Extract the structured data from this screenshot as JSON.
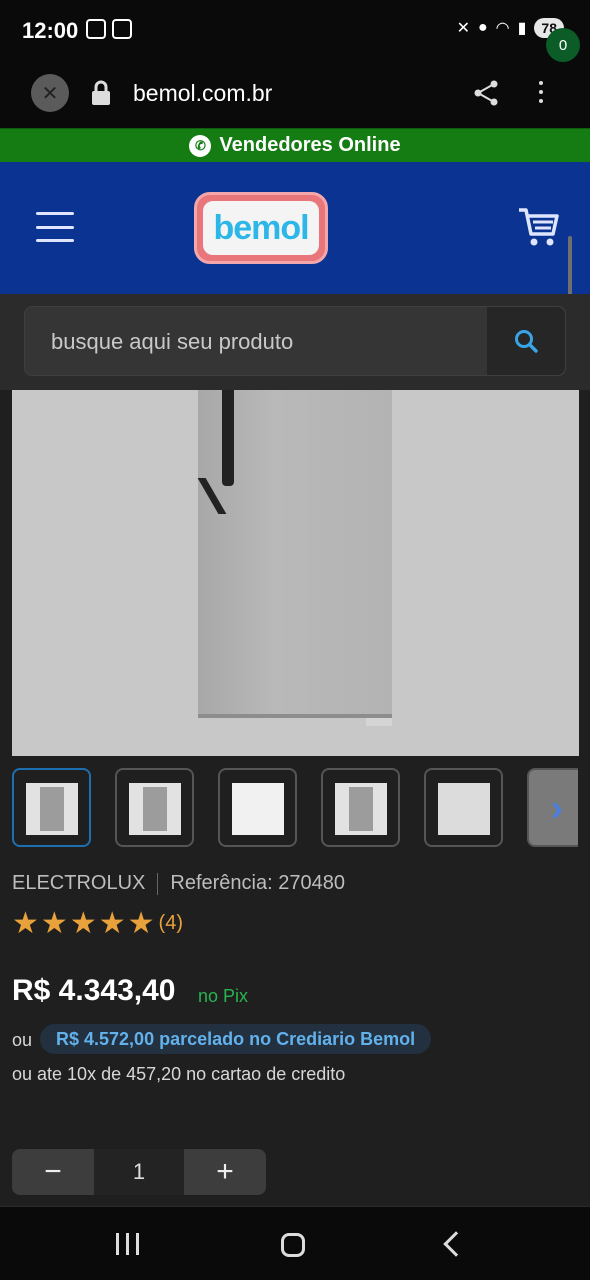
{
  "status": {
    "time": "12:00",
    "battery": "78"
  },
  "browser": {
    "url": "bemol.com.br"
  },
  "banner": {
    "label": "Vendedores Online"
  },
  "header": {
    "logo_text": "bemol",
    "cart_count": "0"
  },
  "search": {
    "placeholder": "busque aqui seu produto"
  },
  "product": {
    "brand": "ELECTROLUX",
    "reference": "Referência: 270480",
    "rating": 5,
    "rating_count": "(4)",
    "price": "R$ 4.343,40",
    "price_suffix": "no Pix",
    "ou_label": "ou",
    "crediario": "R$ 4.572,00 parcelado no Crediario Bemol",
    "installments": "ou ate 10x de 457,20 no cartao de credito"
  },
  "quantity": {
    "minus": "−",
    "value": "1",
    "plus": "+"
  },
  "thumbnails": [
    {
      "name": "thumbnail-front",
      "active": true
    },
    {
      "name": "thumbnail-open",
      "active": false
    },
    {
      "name": "thumbnail-energy-label",
      "active": false
    },
    {
      "name": "thumbnail-side",
      "active": false
    },
    {
      "name": "thumbnail-interior",
      "active": false
    }
  ],
  "colors": {
    "header_blue": "#0b3392",
    "banner_green": "#157c14",
    "price_pix_green": "#28b34f",
    "crediario_blue": "#63b1ea",
    "star_orange": "#e9a23b"
  },
  "icons": [
    "close-icon",
    "lock-icon",
    "share-icon",
    "menu-icon",
    "cart-icon",
    "search-icon",
    "whatsapp-icon",
    "star-icon",
    "chevron-right-icon"
  ]
}
